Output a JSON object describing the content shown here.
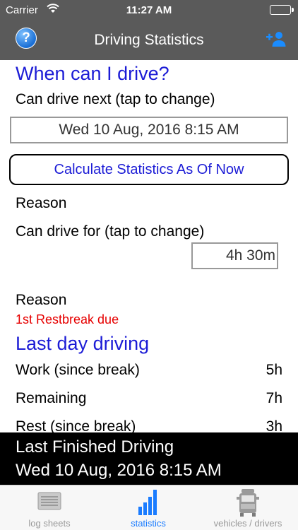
{
  "status_bar": {
    "carrier": "Carrier",
    "time": "11:27 AM"
  },
  "nav": {
    "title": "Driving Statistics",
    "help_label": "?"
  },
  "when_section": {
    "heading": "When can I drive?",
    "can_drive_next_label": "Can drive next (tap to change)",
    "can_drive_next_value": "Wed 10 Aug, 2016 8:15 AM",
    "calculate_button": "Calculate Statistics As Of Now",
    "reason_label_1": "Reason",
    "can_drive_for_label": "Can drive for (tap to change)",
    "can_drive_for_value": "4h 30m",
    "reason_label_2": "Reason",
    "reason_value_2": "1st Restbreak due"
  },
  "last_day": {
    "heading": "Last day driving",
    "rows": [
      {
        "label": "Work (since break)",
        "value": "5h"
      },
      {
        "label": "Remaining",
        "value": "7h"
      },
      {
        "label": "Rest (since break)",
        "value": "3h"
      }
    ]
  },
  "footer": {
    "line1": "Last Finished Driving",
    "line2": "Wed 10 Aug, 2016 8:15 AM"
  },
  "tabs": [
    {
      "label": "log sheets",
      "icon": "log-sheets-icon"
    },
    {
      "label": "statistics",
      "icon": "statistics-icon"
    },
    {
      "label": "vehicles / drivers",
      "icon": "truck-icon"
    }
  ],
  "colors": {
    "nav_bg": "#5a5a5a",
    "heading_blue": "#1c1cd6",
    "reason_red": "#e60000",
    "tab_active": "#1a7cff",
    "tab_inactive": "#999999"
  }
}
